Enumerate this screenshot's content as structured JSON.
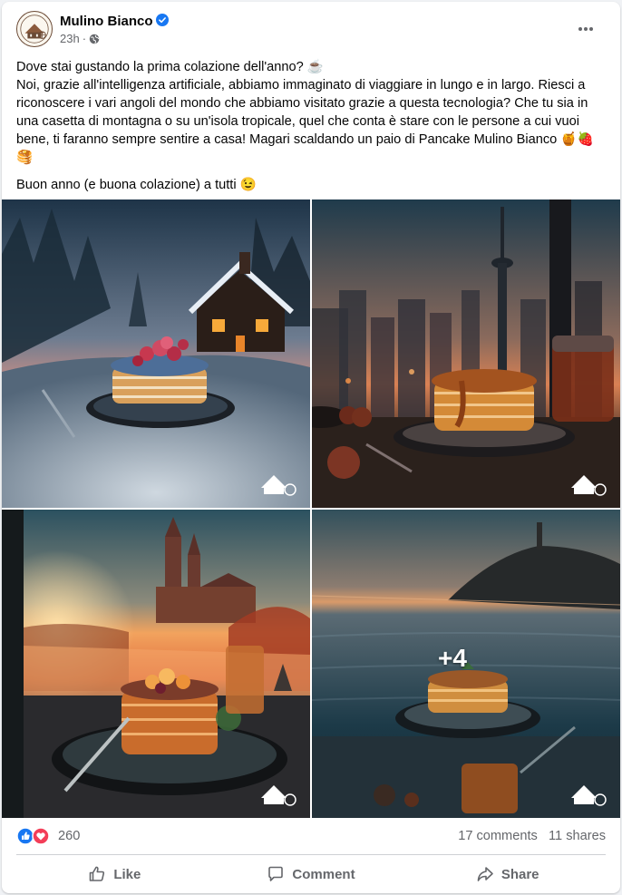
{
  "post": {
    "page_name": "Mulino Bianco",
    "time": "23h",
    "separator": "·",
    "text_line1": "Dove stai gustando la prima colazione dell'anno? ☕",
    "text_line2": "Noi, grazie all'intelligenza artificiale, abbiamo immaginato di viaggiare in lungo e in largo. Riesci a riconoscere i vari angoli del mondo che abbiamo visitato grazie a questa tecnologia? Che tu sia in una casetta di montagna o su un'isola tropicale, quel che conta è stare con le persone a cui vuoi bene, ti faranno sempre sentire a casa! Magari scaldando un paio di Pancake Mulino Bianco 🍯🍓🥞",
    "text_line3": "Buon anno (e buona colazione) a tutti 😉"
  },
  "gallery": {
    "more_count": "+4",
    "images": [
      {
        "name": "snowy-cabin-pancakes"
      },
      {
        "name": "city-skyline-pancakes"
      },
      {
        "name": "cathedral-sunset-pancakes"
      },
      {
        "name": "island-sea-pancakes"
      }
    ]
  },
  "stats": {
    "reaction_count": "260",
    "comments": "17 comments",
    "shares": "11 shares"
  },
  "actions": {
    "like": "Like",
    "comment": "Comment",
    "share": "Share"
  },
  "colors": {
    "brand_blue": "#1877f2",
    "love_red": "#f33e58",
    "secondary_text": "#65676b"
  },
  "icons": [
    "verified-badge-icon",
    "globe-icon",
    "more-options-icon",
    "like-reaction-icon",
    "love-reaction-icon",
    "like-icon",
    "comment-icon",
    "share-icon",
    "mulino-bianco-mill-logo"
  ]
}
